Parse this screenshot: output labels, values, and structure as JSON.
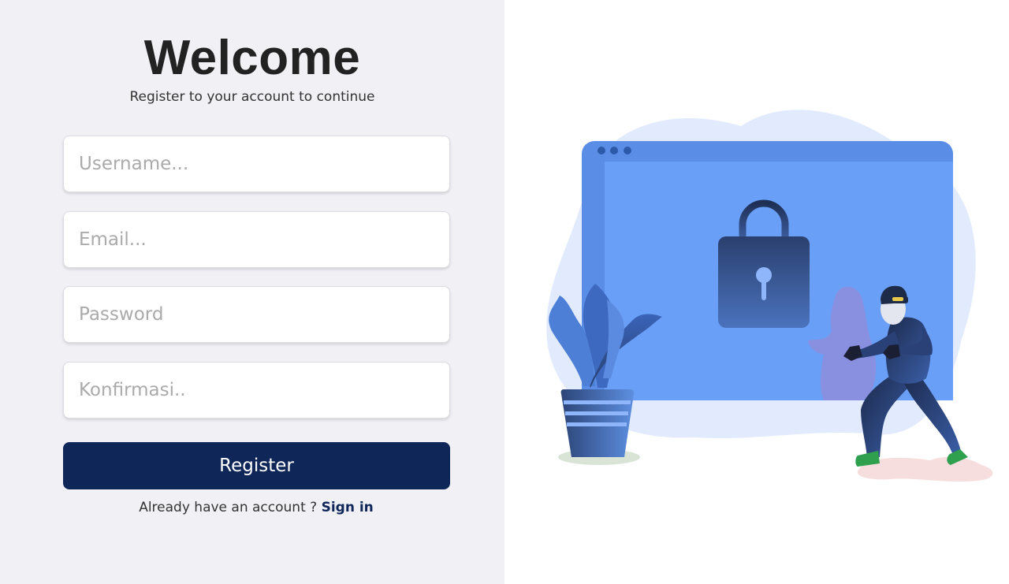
{
  "form": {
    "title": "Welcome",
    "subtitle": "Register to your account to continue",
    "username_placeholder": "Username...",
    "email_placeholder": "Email...",
    "password_placeholder": "Password",
    "confirm_placeholder": "Konfirmasi..",
    "register_label": "Register",
    "signin_prompt": "Already have an account ?",
    "signin_link": "Sign in"
  },
  "colors": {
    "left_panel_bg": "#f0f0f5",
    "button_bg": "#0f2659",
    "link": "#0f2659",
    "browser_blue": "#6a9ff8"
  },
  "illustration": {
    "icons": [
      "lock-icon",
      "plant-icon",
      "thief-figure",
      "browser-window"
    ]
  }
}
